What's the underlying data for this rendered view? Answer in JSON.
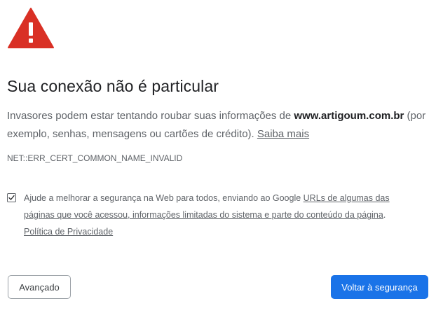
{
  "page": {
    "icon": "warning-triangle-icon",
    "colors": {
      "warning_red": "#d93025",
      "primary_blue": "#1a73e8",
      "text_primary": "#202124",
      "text_secondary": "#5f6368"
    }
  },
  "heading": "Sua conexão não é particular",
  "explanation": {
    "before": "Invasores podem estar tentando roubar suas informações de ",
    "domain": "www.artigoum.com.br",
    "after": " (por exemplo, senhas, mensagens ou cartões de crédito). ",
    "learn_more": "Saiba mais"
  },
  "error_code": "NET::ERR_CERT_COMMON_NAME_INVALID",
  "optin": {
    "checked": true,
    "text_before": "Ajude a melhorar a segurança na Web para todos, enviando ao Google ",
    "link_text": "URLs de algumas das páginas que você acessou, informações limitadas do sistema e parte do conteúdo da página",
    "text_after": ".",
    "privacy_link": "Política de Privacidade"
  },
  "buttons": {
    "advanced": "Avançado",
    "back_to_safety": "Voltar à segurança"
  }
}
